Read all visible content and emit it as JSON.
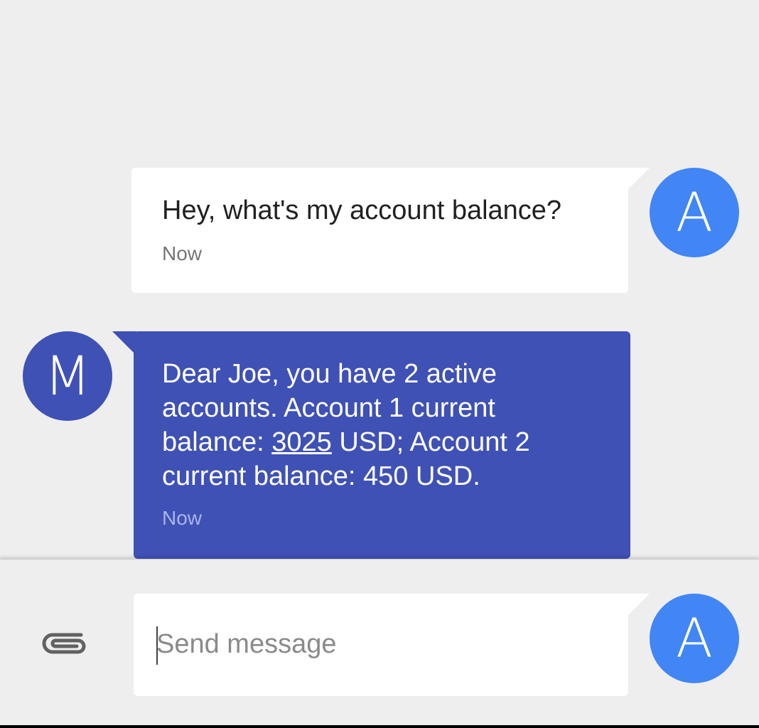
{
  "colors": {
    "background": "#eeeeee",
    "user_bubble": "#ffffff",
    "bot_bubble": "#3f51b5",
    "user_avatar": "#4285f4",
    "bot_avatar": "#3f51b5",
    "bot_timestamp": "#aab4ec",
    "user_timestamp": "#757575"
  },
  "messages": {
    "outgoing": {
      "avatar_letter": "A",
      "text": "Hey, what's my account balance?",
      "timestamp": "Now"
    },
    "incoming": {
      "avatar_letter": "M",
      "text_part1": "Dear Joe, you have 2 active accounts. Account 1 current balance: ",
      "amount_link": "3025",
      "text_part2": " USD; Account 2 current balance:  450 USD.",
      "timestamp": "Now"
    }
  },
  "compose": {
    "attach_icon": "paperclip-icon",
    "placeholder": "Send message",
    "value": "",
    "avatar_letter": "A"
  }
}
